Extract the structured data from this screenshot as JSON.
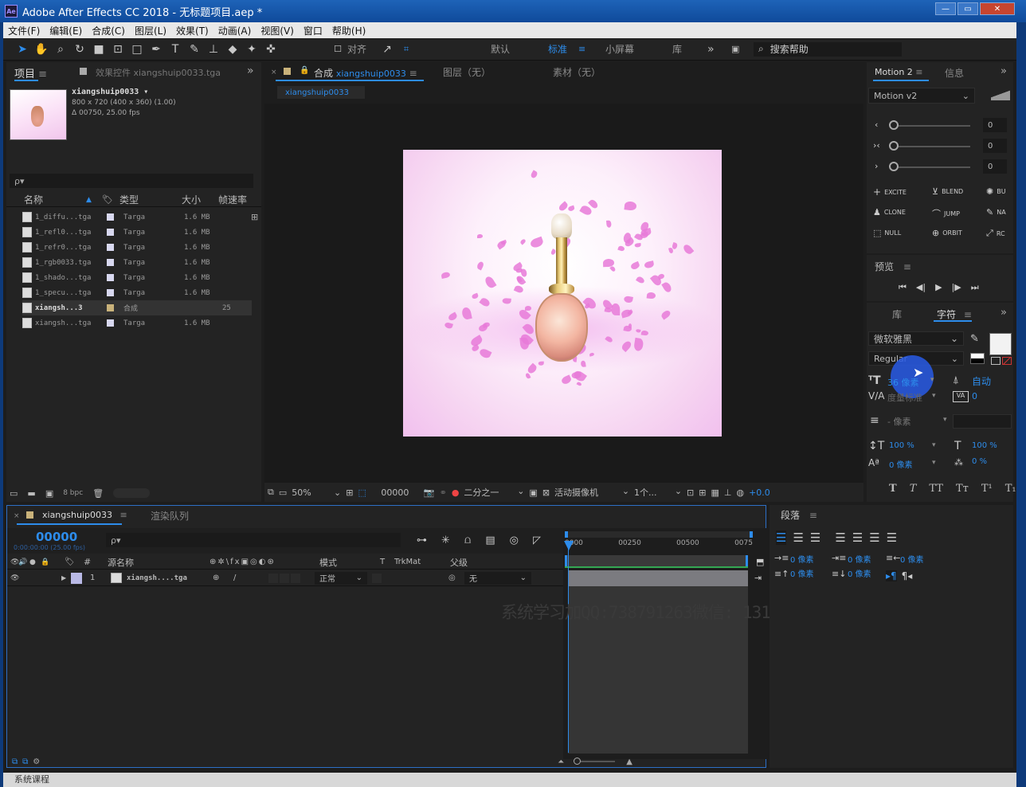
{
  "app": {
    "icon": "Ae",
    "title": "Adobe After Effects CC 2018 - 无标题项目.aep *"
  },
  "window": {
    "min": "—",
    "max": "▭",
    "close": "✕"
  },
  "menu": [
    "文件(F)",
    "编辑(E)",
    "合成(C)",
    "图层(L)",
    "效果(T)",
    "动画(A)",
    "视图(V)",
    "窗口",
    "帮助(H)"
  ],
  "toolbar": {
    "align": "对齐",
    "workspaces": [
      "默认",
      "标准",
      "小屏幕",
      "库"
    ],
    "search_placeholder": "搜索帮助"
  },
  "project": {
    "tab": "项目",
    "effects_tab": "效果控件 xiangshuip0033.tga",
    "item_name": "xiangshuip0033 ▾",
    "item_dims": "800 x 720  (400 x 360) (1.00)",
    "item_time": "Δ 00750, 25.00 fps",
    "search": "ρ▾",
    "columns": [
      "名称",
      "类型",
      "大小",
      "帧速率"
    ],
    "files": [
      {
        "name": "1_diffu...tga",
        "type": "Targa",
        "size": "1.6 MB",
        "fps": "",
        "color": "#d8d8f0"
      },
      {
        "name": "1_refl0...tga",
        "type": "Targa",
        "size": "1.6 MB",
        "fps": "",
        "color": "#d8d8f0"
      },
      {
        "name": "1_refr0...tga",
        "type": "Targa",
        "size": "1.6 MB",
        "fps": "",
        "color": "#d8d8f0"
      },
      {
        "name": "1_rgb0033.tga",
        "type": "Targa",
        "size": "1.6 MB",
        "fps": "",
        "color": "#d8d8f0"
      },
      {
        "name": "1_shado...tga",
        "type": "Targa",
        "size": "1.6 MB",
        "fps": "",
        "color": "#d8d8f0"
      },
      {
        "name": "1_specu...tga",
        "type": "Targa",
        "size": "1.6 MB",
        "fps": "",
        "color": "#d8d8f0"
      },
      {
        "name": "xiangsh...3",
        "type": "合成",
        "size": "",
        "fps": "25",
        "color": "#c9b27a"
      },
      {
        "name": "xiangsh...tga",
        "type": "Targa",
        "size": "1.6 MB",
        "fps": "",
        "color": "#d8d8f0"
      }
    ],
    "bpc": "8 bpc"
  },
  "comp": {
    "tab_label": "合成",
    "comp_name": "xiangshuip0033",
    "layer_tab": "图层（无）",
    "footage_tab": "素材（无）",
    "subtab": "xiangshuip0033",
    "zoom": "50%",
    "timecode": "00000",
    "resolution": "二分之一",
    "camera": "活动摄像机",
    "views": "1个...",
    "exposure": "+0.0"
  },
  "motion": {
    "tab": "Motion 2",
    "info_tab": "信息",
    "preset": "Motion v2",
    "values": [
      "0",
      "0",
      "0"
    ],
    "buttons": [
      "EXCITE",
      "BLEND",
      "BU",
      "CLONE",
      "JUMP",
      "NA",
      "NULL",
      "ORBIT",
      "RC"
    ]
  },
  "preview": {
    "tab": "预览"
  },
  "character": {
    "lib_tab": "库",
    "tab": "字符",
    "font": "微软雅黑",
    "style": "Regular",
    "size": "36 像素",
    "auto": "自动",
    "kerning": "度量标准",
    "tracking": "0",
    "stroke": "- 像素",
    "vscale": "100 %",
    "hscale": "100 %",
    "baseline": "0 像素",
    "tsume": "0 %",
    "styles": [
      "T",
      "T",
      "TT",
      "Tт",
      "T¹",
      "T₁"
    ]
  },
  "paragraph": {
    "tab": "段落",
    "indent_left": "0 像素",
    "indent_right": "0 像素",
    "indent_first": "0 像素",
    "space_before": "0 像素",
    "space_after": "0 像素"
  },
  "timeline": {
    "tab": "xiangshuip0033",
    "render_tab": "渲染队列",
    "timecode": "00000",
    "timecode_sub": "0:00:00:00 (25.00 fps)",
    "search": "ρ▾",
    "columns": {
      "num": "#",
      "source": "源名称",
      "mode": "模式",
      "t": "T",
      "trkmat": "TrkMat",
      "parent": "父级"
    },
    "layer": {
      "index": "1",
      "name": "xiangsh....tga",
      "mode": "正常",
      "parent": "无"
    },
    "ruler": [
      "0000",
      "00250",
      "00500",
      "0075"
    ]
  },
  "watermark": "系统学习加QQ:738791263微信: 13142214939",
  "taskbar": "系统课程"
}
